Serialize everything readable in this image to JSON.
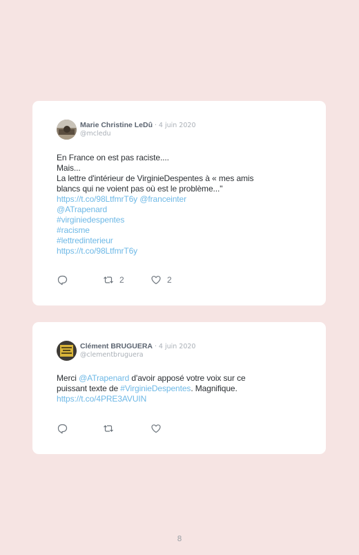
{
  "tweets": [
    {
      "author": "Marie Christine LeDû",
      "separator": "·",
      "date": "4 juin 2020",
      "handle": "@mcledu",
      "lines": [
        [
          {
            "text": "En France on est pas raciste...."
          }
        ],
        [
          {
            "text": "Mais..."
          }
        ],
        [
          {
            "text": "La lettre d'intérieur de VirginieDespentes à « mes amis"
          }
        ],
        [
          {
            "text": "blancs qui ne voient pas où est le problème...\""
          }
        ],
        [
          {
            "text": "https://t.co/98LtfmrT6y",
            "link": true
          },
          {
            "text": " "
          },
          {
            "text": "@franceinter",
            "link": true
          }
        ],
        [
          {
            "text": "@ATrapenard",
            "link": true
          }
        ],
        [
          {
            "text": "#virginiedespentes",
            "link": true
          }
        ],
        [
          {
            "text": "#racisme",
            "link": true
          }
        ],
        [
          {
            "text": "#lettredinterieur",
            "link": true
          }
        ],
        [
          {
            "text": "https://t.co/98LtfmrT6y",
            "link": true
          }
        ]
      ],
      "retweet_count": "2",
      "like_count": "2",
      "icons": [
        "reply-icon",
        "retweet-icon",
        "heart-icon"
      ]
    },
    {
      "author": "Clément BRUGUERA",
      "separator": "·",
      "date": "4 juin 2020",
      "handle": "@clementbruguera",
      "lines": [
        [
          {
            "text": "Merci "
          },
          {
            "text": "@ATrapenard",
            "link": true
          },
          {
            "text": " d'avoir apposé votre voix sur ce"
          }
        ],
        [
          {
            "text": "puissant texte de "
          },
          {
            "text": "#VirginieDespentes",
            "link": true
          },
          {
            "text": ". Magnifique."
          }
        ],
        [
          {
            "text": "https://t.co/4PRE3AVUIN",
            "link": true
          }
        ]
      ],
      "retweet_count": "",
      "like_count": "",
      "icons": [
        "reply-icon",
        "retweet-icon",
        "heart-icon"
      ]
    }
  ],
  "page_number": "8",
  "colors": {
    "background": "#f6e4e3",
    "card": "#ffffff",
    "link": "#6db8e6",
    "name": "#5b6470",
    "muted": "#aab0b7"
  }
}
